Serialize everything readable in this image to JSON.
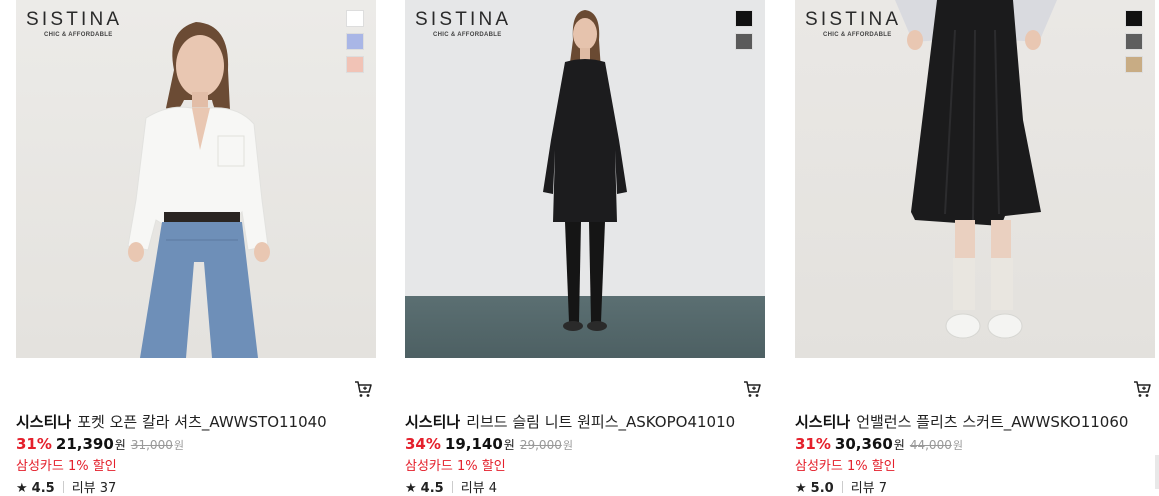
{
  "products": [
    {
      "logo": {
        "name": "SISTINA",
        "tagline": "CHIC & AFFORDABLE"
      },
      "swatches": [
        "#ffffff",
        "#a9b6e6",
        "#f1c3b6"
      ],
      "brand": "시스티나",
      "name": "포켓 오픈 칼라 셔츠_AWWSTO11040",
      "discount": "31%",
      "price": "21,390",
      "price_unit": "원",
      "original_price": "31,000",
      "original_unit": "원",
      "promo": "삼성카드 1% 할인",
      "rating": "4.5",
      "reviews": "리뷰 37",
      "cart_icon": "cart-icon"
    },
    {
      "logo": {
        "name": "SISTINA",
        "tagline": "CHIC & AFFORDABLE"
      },
      "swatches": [
        "#111111",
        "#5a5a5a"
      ],
      "brand": "시스티나",
      "name": "리브드 슬림 니트 원피스_ASKOPO41010",
      "discount": "34%",
      "price": "19,140",
      "price_unit": "원",
      "original_price": "29,000",
      "original_unit": "원",
      "promo": "삼성카드 1% 할인",
      "rating": "4.5",
      "reviews": "리뷰 4",
      "cart_icon": "cart-icon"
    },
    {
      "logo": {
        "name": "SISTINA",
        "tagline": "CHIC & AFFORDABLE"
      },
      "swatches": [
        "#111111",
        "#5e5e5e",
        "#c8ac84"
      ],
      "brand": "시스티나",
      "name": "언밸런스 플리츠 스커트_AWWSKO11060",
      "discount": "31%",
      "price": "30,360",
      "price_unit": "원",
      "original_price": "44,000",
      "original_unit": "원",
      "promo": "삼성카드 1% 할인",
      "rating": "5.0",
      "reviews": "리뷰 7",
      "cart_icon": "cart-icon"
    }
  ],
  "colors": {
    "accent": "#e4202c",
    "strike": "#999999"
  }
}
